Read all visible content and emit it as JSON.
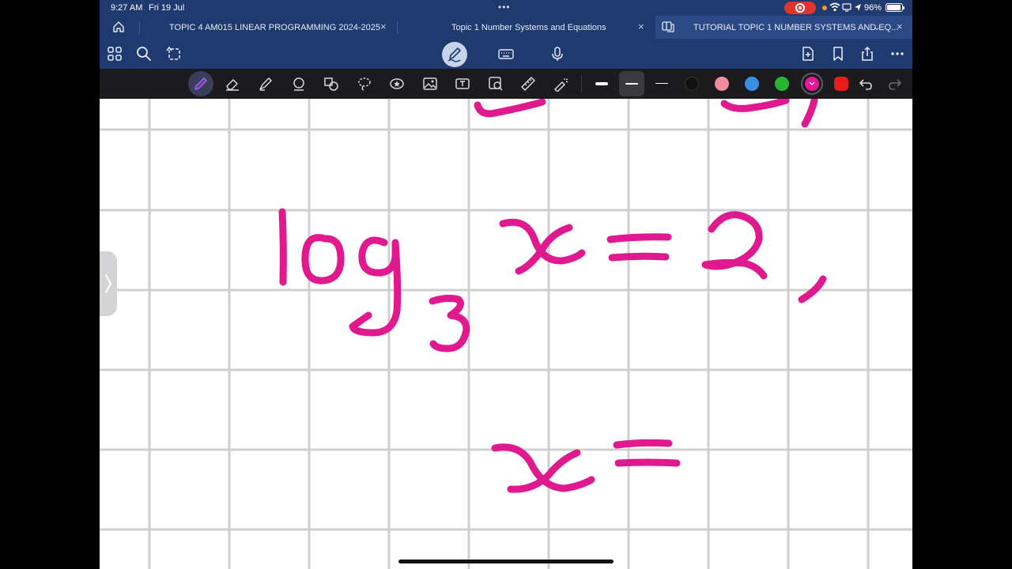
{
  "status_bar": {
    "time": "9:27 AM",
    "date": "Fri 19 Jul",
    "multitask_dots": "•••",
    "battery": "96%"
  },
  "tabs": [
    {
      "label": "TOPIC 4 AM015 LINEAR PROGRAMMING 2024-2025",
      "close": "×",
      "active": false
    },
    {
      "label": "Topic 1 Number Systems and Equations",
      "close": "×",
      "active": false
    },
    {
      "label": "TUTORIAL TOPIC 1 NUMBER SYSTEMS AND EQ...",
      "close": "×",
      "active": true
    }
  ],
  "tab_dropdown": "⌄",
  "drawing_colors": {
    "white": "#ffffff",
    "black": "#111111",
    "light_pink": "#f28ca0",
    "blue": "#3a8ee6",
    "green": "#27b536",
    "magenta_selected": "#e8179a",
    "red": "#e81b1b"
  },
  "ink_color": "#e0198f",
  "handwriting": {
    "line1": "log3 x = 2 ,",
    "line2": "x ="
  },
  "icons": {
    "home": "home-icon",
    "grid": "thumbnails-icon",
    "search": "search-icon",
    "sync": "sync-icon",
    "pen_mode": "pen-mode-icon",
    "keyboard": "keyboard-icon",
    "mic": "microphone-icon",
    "add_page": "add-page-icon",
    "bookmark": "bookmark-icon",
    "share": "share-icon",
    "more": "more-icon"
  }
}
